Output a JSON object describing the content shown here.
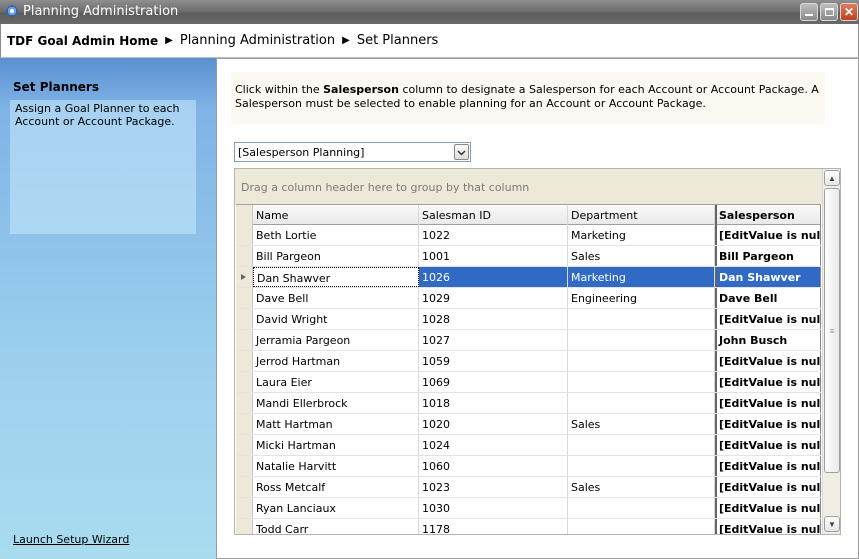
{
  "window": {
    "title": "Planning Administration",
    "icon": "app-gear-icon",
    "buttons": [
      "minimize",
      "maximize",
      "close"
    ]
  },
  "breadcrumb": {
    "home": "TDF Goal Admin Home",
    "items": [
      "Planning Administration",
      "Set Planners"
    ]
  },
  "sidebar": {
    "heading": "Set Planners",
    "description": "Assign a Goal Planner to each Account or Account Package.",
    "wizard_link": "Launch Setup Wizard"
  },
  "main": {
    "instructions_pre": "Click within the ",
    "instructions_bold": "Salesperson",
    "instructions_post": " column to designate a Salesperson for each Account or Account Package.  A Salesperson must be selected to enable planning for an Account or Account Package.",
    "dropdown_value": "[Salesperson Planning]",
    "group_hint": "Drag a column header here to group by that column",
    "columns": {
      "name": "Name",
      "id": "Salesman ID",
      "department": "Department",
      "salesperson": "Salesperson"
    },
    "rows": [
      {
        "name": "Beth Lortie",
        "id": "1022",
        "department": "Marketing",
        "salesperson": "[EditValue is null]"
      },
      {
        "name": "Bill Pargeon",
        "id": "1001",
        "department": "Sales",
        "salesperson": "Bill Pargeon"
      },
      {
        "name": "Dan Shawver",
        "id": "1026",
        "department": "Marketing",
        "salesperson": "Dan Shawver",
        "selected": true
      },
      {
        "name": "Dave Bell",
        "id": "1029",
        "department": "Engineering",
        "salesperson": "Dave Bell"
      },
      {
        "name": "David Wright",
        "id": "1028",
        "department": "",
        "salesperson": "[EditValue is null]"
      },
      {
        "name": "Jerramia Pargeon",
        "id": "1027",
        "department": "",
        "salesperson": "John Busch"
      },
      {
        "name": "Jerrod Hartman",
        "id": "1059",
        "department": "",
        "salesperson": "[EditValue is null]"
      },
      {
        "name": "Laura Eier",
        "id": "1069",
        "department": "",
        "salesperson": "[EditValue is null]"
      },
      {
        "name": "Mandi Ellerbrock",
        "id": "1018",
        "department": "",
        "salesperson": "[EditValue is null]"
      },
      {
        "name": "Matt Hartman",
        "id": "1020",
        "department": "Sales",
        "salesperson": "[EditValue is null]"
      },
      {
        "name": "Micki Hartman",
        "id": "1024",
        "department": "",
        "salesperson": "[EditValue is null]"
      },
      {
        "name": "Natalie Harvitt",
        "id": "1060",
        "department": "",
        "salesperson": "[EditValue is null]"
      },
      {
        "name": "Ross Metcalf",
        "id": "1023",
        "department": "Sales",
        "salesperson": "[EditValue is null]"
      },
      {
        "name": "Ryan Lanciaux",
        "id": "1030",
        "department": "",
        "salesperson": "[EditValue is null]"
      },
      {
        "name": "Todd Carr",
        "id": "1178",
        "department": "",
        "salesperson": "[EditValue is null]"
      }
    ]
  },
  "colors": {
    "selection": "#316ac5",
    "sidebar_top": "#5a8fd0",
    "sidebar_bottom": "#a9dcef"
  }
}
